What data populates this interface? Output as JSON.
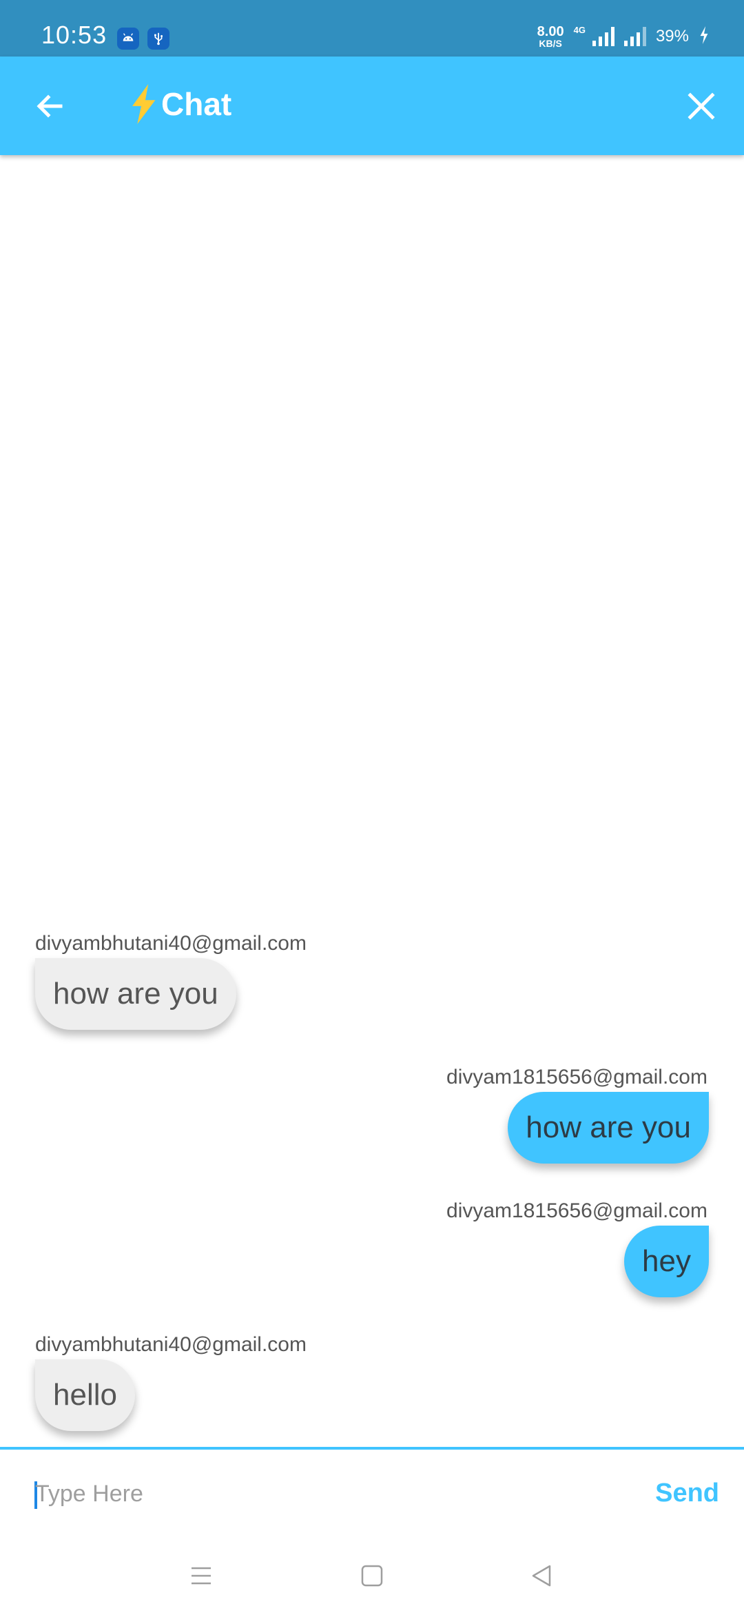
{
  "status_bar": {
    "time": "10:53",
    "net_speed_value": "8.00",
    "net_speed_unit": "KB/S",
    "network_type": "4G",
    "battery": "39%",
    "app_icons": [
      "android-debug-icon",
      "usb-icon"
    ]
  },
  "app_bar": {
    "title_emoji": "⚡",
    "title": "Chat",
    "back_icon": "arrow-left-icon",
    "close_icon": "close-icon"
  },
  "messages": [
    {
      "sender": "divyambhutani40@gmail.com",
      "text": "how are you",
      "direction": "incoming"
    },
    {
      "sender": "divyam1815656@gmail.com",
      "text": "how are you",
      "direction": "outgoing"
    },
    {
      "sender": "divyam1815656@gmail.com",
      "text": "hey",
      "direction": "outgoing"
    },
    {
      "sender": "divyambhutani40@gmail.com",
      "text": "hello",
      "direction": "incoming"
    }
  ],
  "composer": {
    "placeholder": "Type Here",
    "value": "",
    "send_label": "Send"
  },
  "nav_bar": {
    "buttons": [
      "menu-icon",
      "home-square-icon",
      "back-triangle-icon"
    ]
  },
  "colors": {
    "status_bar": "#318fbf",
    "accent": "#40c4ff",
    "incoming_bubble": "#eeeeee",
    "outgoing_bubble": "#40c4ff"
  }
}
